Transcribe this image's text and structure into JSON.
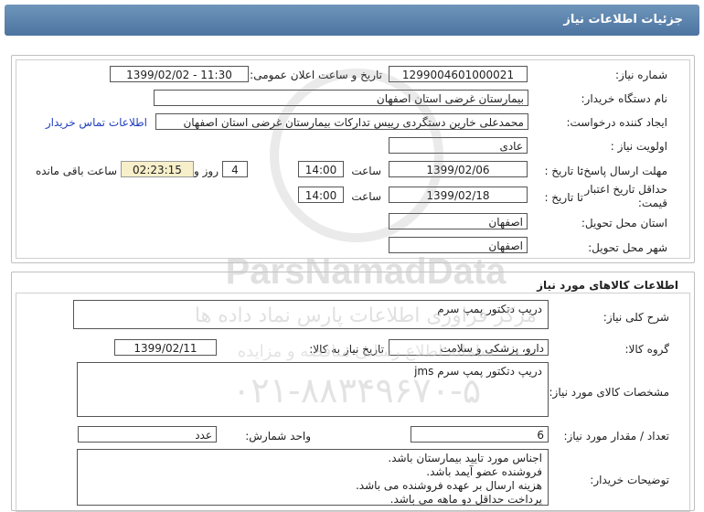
{
  "header": {
    "title": "جزئیات اطلاعات نیاز"
  },
  "info": {
    "need_number_label": "شماره نیاز:",
    "need_number": "1299004601000021",
    "announce_label": "تاریخ و ساعت اعلان عمومی:",
    "announce_value": "1399/02/02 - 11:30",
    "buyer_label": "نام دستگاه خریدار:",
    "buyer_value": "بیمارستان غرضی استان اصفهان",
    "creator_label": "ایجاد کننده درخواست:",
    "creator_value": "محمدعلی خارین دستگردی رییس تدارکات بیمارستان غرضی استان اصفهان",
    "contact_link": "اطلاعات تماس خریدار",
    "priority_label": "اولویت نیاز :",
    "priority_value": "عادی",
    "deadline_label": "مهلت ارسال پاسخ:",
    "to_date_label": "تا تاریخ :",
    "deadline_date": "1399/02/06",
    "hour_label": "ساعت",
    "deadline_time": "14:00",
    "days_value": "4",
    "days_label": "روز و",
    "remaining_time": "02:23:15",
    "remaining_label": "ساعت باقی مانده",
    "validity_label": "حداقل تاریخ اعتبار قیمت:",
    "validity_date": "1399/02/18",
    "validity_time": "14:00",
    "province_label": "استان محل تحویل:",
    "province_value": "اصفهان",
    "city_label": "شهر محل تحویل:",
    "city_value": "اصفهان"
  },
  "goods": {
    "section_title": "اطلاعات کالاهای مورد نیاز",
    "summary_label": "شرح کلی نیاز:",
    "summary_value": "دریپ دتکتور پمپ سرم",
    "group_label": "گروه کالا:",
    "group_value": "دارو، پزشکی و سلامت",
    "need_date_label": "تاریخ نیاز به کالا:",
    "need_date_value": "1399/02/11",
    "spec_label": "مشخصات کالای مورد نیاز:",
    "spec_value": "دریپ دتکتور پمپ سرم jms",
    "qty_label": "تعداد / مقدار مورد نیاز:",
    "qty_value": "6",
    "unit_label": "واحد شمارش:",
    "unit_value": "عدد",
    "notes_label": "توضیحات خریدار:",
    "notes_lines": [
      "اجناس مورد تایید بیمارستان باشد.",
      "فروشنده عضو آیمد باشد.",
      "هزینه ارسال بر عهده فروشنده می باشد.",
      "پرداخت حداقل دو ماهه می باشد."
    ]
  },
  "watermark": {
    "brand": "ParsNamadData",
    "line1": "مرکز فراوری اطلاعات پارس نماد داده ها",
    "line2": "سامانه اطلاع رسانی مناقصه و مزایده",
    "phone": "۰۲۱-۸۸۳۴۹۶۷۰-۵",
    "colors": {
      "watermark": "#c8c8c8",
      "header": "#5a80a9",
      "link": "#1f3fbf",
      "remaining_bg": "#f7efc9"
    }
  }
}
